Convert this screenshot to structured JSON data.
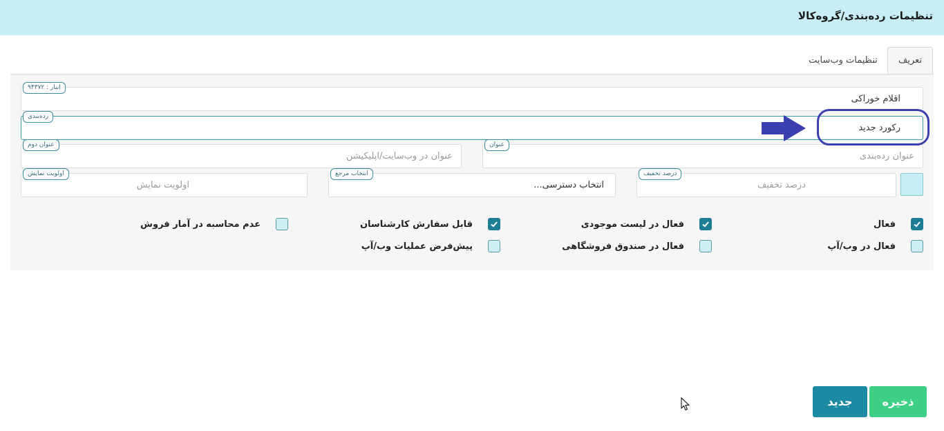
{
  "header": {
    "title": "تنظیمات رده‌بندی/گروه‌کالا"
  },
  "tabs": [
    {
      "label": "تعریف",
      "active": true
    },
    {
      "label": "تنظیمات وب‌سایت",
      "active": false
    }
  ],
  "form": {
    "warehouse": {
      "value": "اقلام خوراکی",
      "tag": "انبار : ۹۴۳۷۲"
    },
    "category": {
      "value": "رکورد جدید",
      "tag": "رده‌بندی"
    },
    "title": {
      "placeholder": "عنوان رده‌بندی",
      "tag": "عنوان"
    },
    "second_title": {
      "placeholder": "عنوان در وب‌سایت/اپلیکیشن",
      "tag": "عنوان دوم"
    },
    "discount": {
      "placeholder": "درصد تخفیف",
      "tag": "درصد تخفیف"
    },
    "reference": {
      "value": "انتخاب دسترسی...",
      "tag": "انتخاب مرجع"
    },
    "priority": {
      "placeholder": "اولویت نمایش",
      "tag": "اولویت نمایش"
    }
  },
  "checkboxes": [
    {
      "label": "فعال",
      "checked": true
    },
    {
      "label": "فعال در لیست موجودی",
      "checked": true
    },
    {
      "label": "قابل سفارش کارشناسان",
      "checked": true
    },
    {
      "label": "عدم محاسبه در آمار فروش",
      "checked": false
    },
    {
      "label": "فعال در وب/آپ",
      "checked": false
    },
    {
      "label": "فعال در صندوق فروشگاهی",
      "checked": false
    },
    {
      "label": "پیش‌فرض عملیات وب/آپ",
      "checked": false
    }
  ],
  "buttons": {
    "save": "ذخیره",
    "new": "جدید"
  },
  "colors": {
    "header_bg": "#c8edf5",
    "accent": "#1f7e95",
    "save_button": "#3ccf85",
    "new_button": "#1d8aa3",
    "annotation": "#3b3fb0"
  }
}
